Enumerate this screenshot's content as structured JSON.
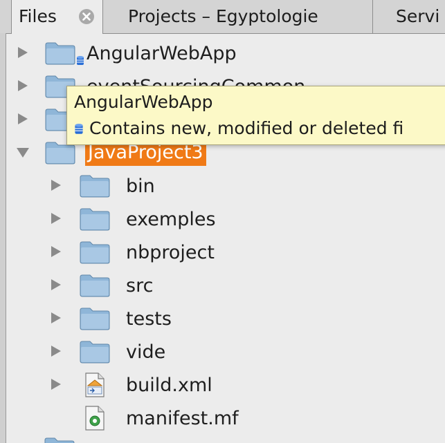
{
  "tabs": {
    "files": "Files",
    "projects": "Projects – Egyptologie",
    "services": "Servi"
  },
  "tree": {
    "top_level": [
      {
        "label": "AngularWebApp",
        "badge": "db-badge-icon",
        "expanded": false
      },
      {
        "label": "eventSourcingCommon",
        "expanded": false
      },
      {
        "label": "",
        "expanded": false
      },
      {
        "label": "JavaProject3",
        "expanded": true,
        "selected": true
      }
    ],
    "children": [
      {
        "label": "bin",
        "type": "folder"
      },
      {
        "label": "exemples",
        "type": "folder"
      },
      {
        "label": "nbproject",
        "type": "folder"
      },
      {
        "label": "src",
        "type": "folder"
      },
      {
        "label": "tests",
        "type": "folder"
      },
      {
        "label": "vide",
        "type": "folder"
      },
      {
        "label": "build.xml",
        "type": "ant-file"
      },
      {
        "label": "manifest.mf",
        "type": "manifest-file"
      }
    ]
  },
  "tooltip": {
    "title": "AngularWebApp",
    "message": "Contains new, modified or deleted fi"
  },
  "colors": {
    "selection": "#f07a16",
    "tooltip_bg": "#fcf9c7",
    "folder_blue": "#8fb6d8",
    "badge_blue": "#2a6fd6"
  }
}
